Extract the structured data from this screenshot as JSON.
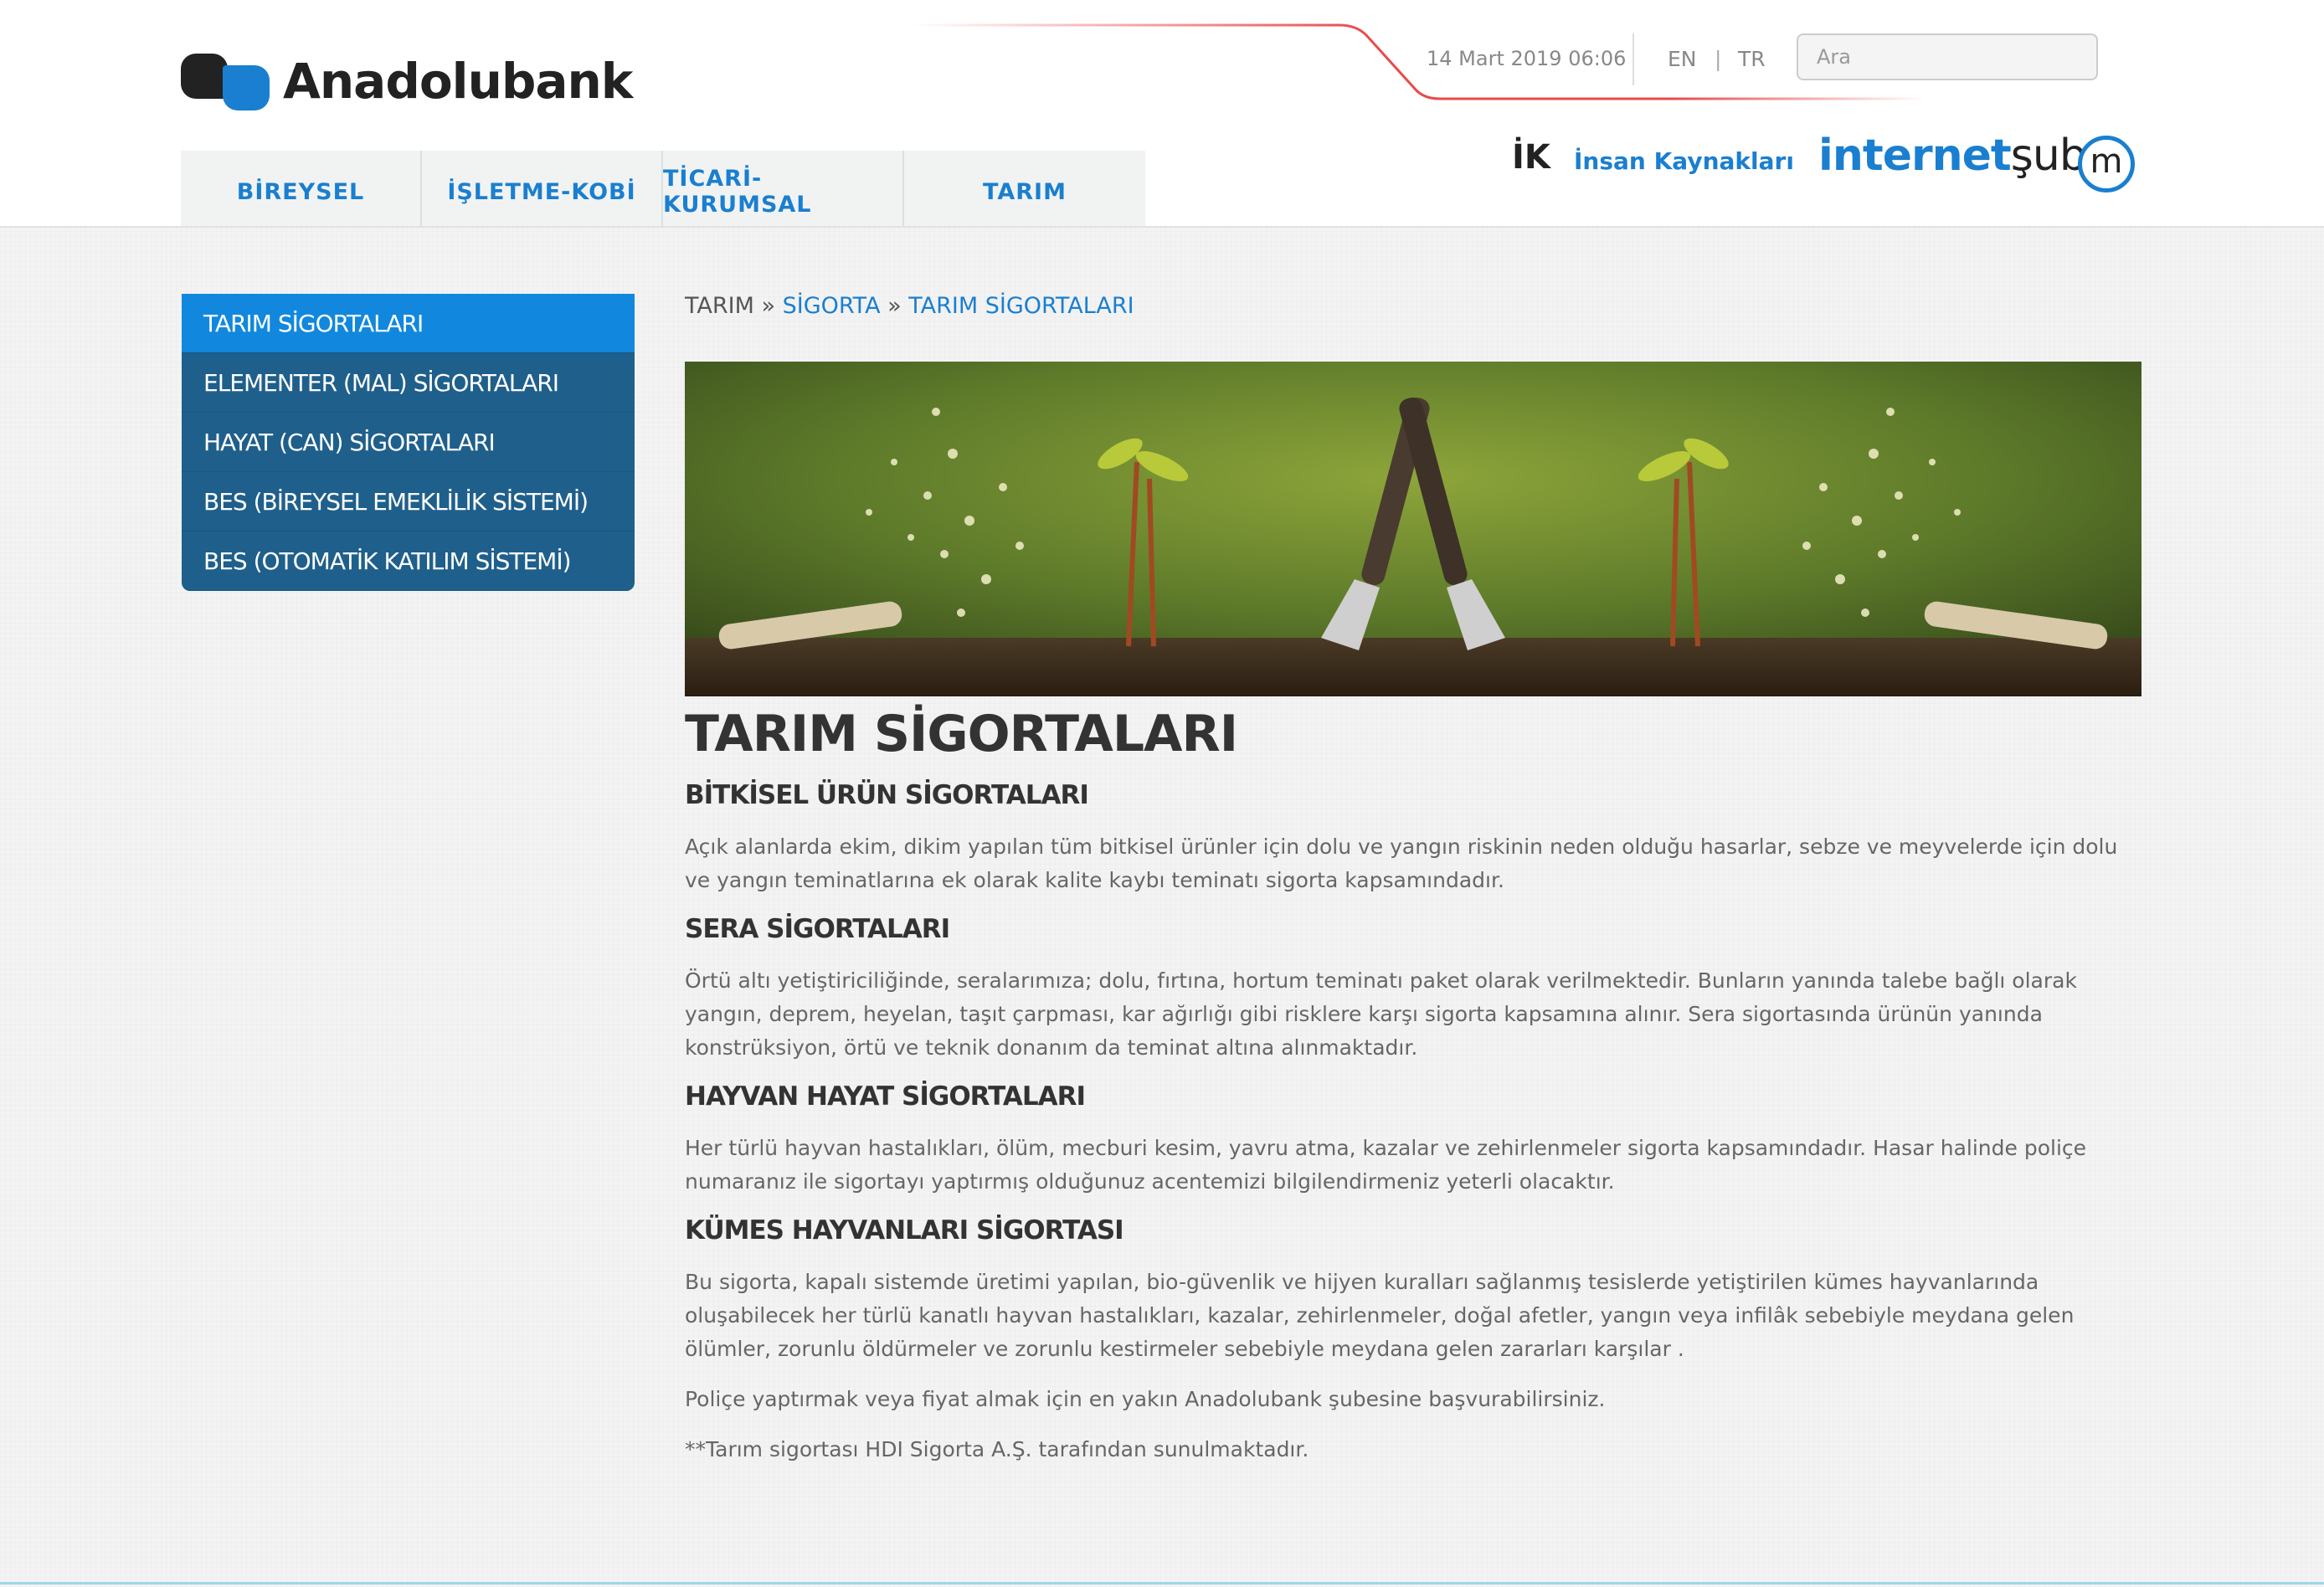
{
  "header": {
    "logo_text": "Anadolubank",
    "date": "14 Mart 2019 06:06",
    "lang_en": "EN",
    "lang_sep": "|",
    "lang_tr": "TR",
    "search_placeholder": "Ara",
    "ik_mark": "İK",
    "ik_label": "İnsan Kaynakları",
    "internet_sube_a": "internet",
    "internet_sube_b": "şube",
    "internet_sube_m": "m"
  },
  "main_nav": [
    {
      "label": "BİREYSEL"
    },
    {
      "label": "İŞLETME-KOBİ"
    },
    {
      "label": "TİCARİ-KURUMSAL"
    },
    {
      "label": "TARIM"
    }
  ],
  "side_menu": [
    {
      "label": "TARIM SİGORTALARI",
      "active": true
    },
    {
      "label": "ELEMENTER (MAL) SİGORTALARI"
    },
    {
      "label": "HAYAT (CAN) SİGORTALARI"
    },
    {
      "label": "BES (BİREYSEL EMEKLİLİK SİSTEMİ)"
    },
    {
      "label": "BES (OTOMATİK KATILIM SİSTEMİ)"
    }
  ],
  "breadcrumb": {
    "root": "TARIM",
    "sep": "»",
    "level1": "SİGORTA",
    "level2": "TARIM SİGORTALARI"
  },
  "page_title": "TARIM SİGORTALARI",
  "sections": [
    {
      "heading": "BİTKİSEL ÜRÜN SİGORTALARI",
      "body": "Açık alanlarda ekim, dikim yapılan tüm bitkisel ürünler için dolu ve yangın riskinin neden olduğu hasarlar, sebze ve meyvelerde için dolu ve yangın teminatlarına ek olarak kalite kaybı teminatı sigorta kapsamındadır."
    },
    {
      "heading": "SERA SİGORTALARI",
      "body": "Örtü altı yetiştiriciliğinde, seralarımıza; dolu, fırtına, hortum teminatı paket olarak verilmektedir. Bunların yanında talebe bağlı olarak yangın, deprem, heyelan, taşıt çarpması, kar ağırlığı gibi risklere karşı sigorta kapsamına alınır. Sera sigortasında ürünün yanında konstrüksiyon, örtü ve teknik donanım da teminat altına alınmaktadır."
    },
    {
      "heading": "HAYVAN HAYAT SİGORTALARI",
      "body": "Her türlü hayvan hastalıkları, ölüm, mecburi kesim, yavru atma, kazalar ve zehirlenmeler sigorta kapsamındadır. Hasar halinde poliçe numaranız ile sigortayı yaptırmış olduğunuz acentemizi bilgilendirmeniz yeterli olacaktır."
    },
    {
      "heading": "KÜMES HAYVANLARI SİGORTASI",
      "body": "Bu sigorta, kapalı sistemde üretimi yapılan, bio-güvenlik ve hijyen kuralları sağlanmış tesislerde yetiştirilen kümes hayvanlarında oluşabilecek her türlü kanatlı hayvan hastalıkları, kazalar, zehirlenmeler, doğal afetler, yangın veya infilâk sebebiyle meydana gelen ölümler, zorunlu öldürmeler ve zorunlu kestirmeler sebebiyle meydana gelen zararları karşılar ."
    }
  ],
  "footer_notes": [
    "Poliçe yaptırmak veya fiyat almak için en yakın Anadolubank şubesine başvurabilirsiniz.",
    "**Tarım sigortası HDI Sigorta A.Ş. tarafından sunulmaktadır."
  ],
  "colors": {
    "brand_blue": "#1a7fd0",
    "menu_dark": "#1f5f8b",
    "menu_active": "#1188dd",
    "accent_red": "#e84a4a"
  }
}
